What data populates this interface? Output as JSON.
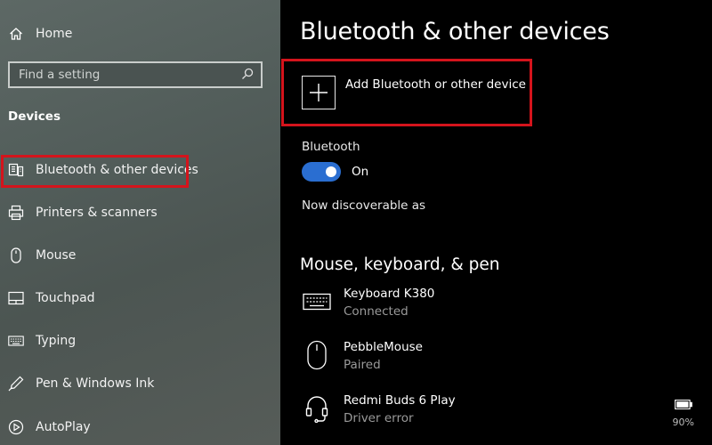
{
  "sidebar": {
    "home_label": "Home",
    "search_placeholder": "Find a setting",
    "section_title": "Devices",
    "items": [
      {
        "label": "Bluetooth & other devices",
        "icon": "bluetooth-devices-icon"
      },
      {
        "label": "Printers & scanners",
        "icon": "printer-icon"
      },
      {
        "label": "Mouse",
        "icon": "mouse-icon"
      },
      {
        "label": "Touchpad",
        "icon": "touchpad-icon"
      },
      {
        "label": "Typing",
        "icon": "keyboard-icon"
      },
      {
        "label": "Pen & Windows Ink",
        "icon": "pen-icon"
      },
      {
        "label": "AutoPlay",
        "icon": "autoplay-icon"
      }
    ]
  },
  "main": {
    "title": "Bluetooth & other devices",
    "add_device_label": "Add Bluetooth or other device",
    "bluetooth_label": "Bluetooth",
    "bluetooth_state": "On",
    "discoverable_text": "Now discoverable as",
    "section_heading": "Mouse, keyboard, & pen",
    "devices": [
      {
        "name": "Keyboard K380",
        "status": "Connected",
        "icon": "keyboard-icon"
      },
      {
        "name": "PebbleMouse",
        "status": "Paired",
        "icon": "mouse-icon"
      },
      {
        "name": "Redmi Buds 6 Play",
        "status": "Driver error",
        "icon": "headset-icon"
      }
    ],
    "battery_percent": "90%"
  },
  "colors": {
    "accent": "#2a6ed1",
    "highlight": "#d4141c"
  }
}
